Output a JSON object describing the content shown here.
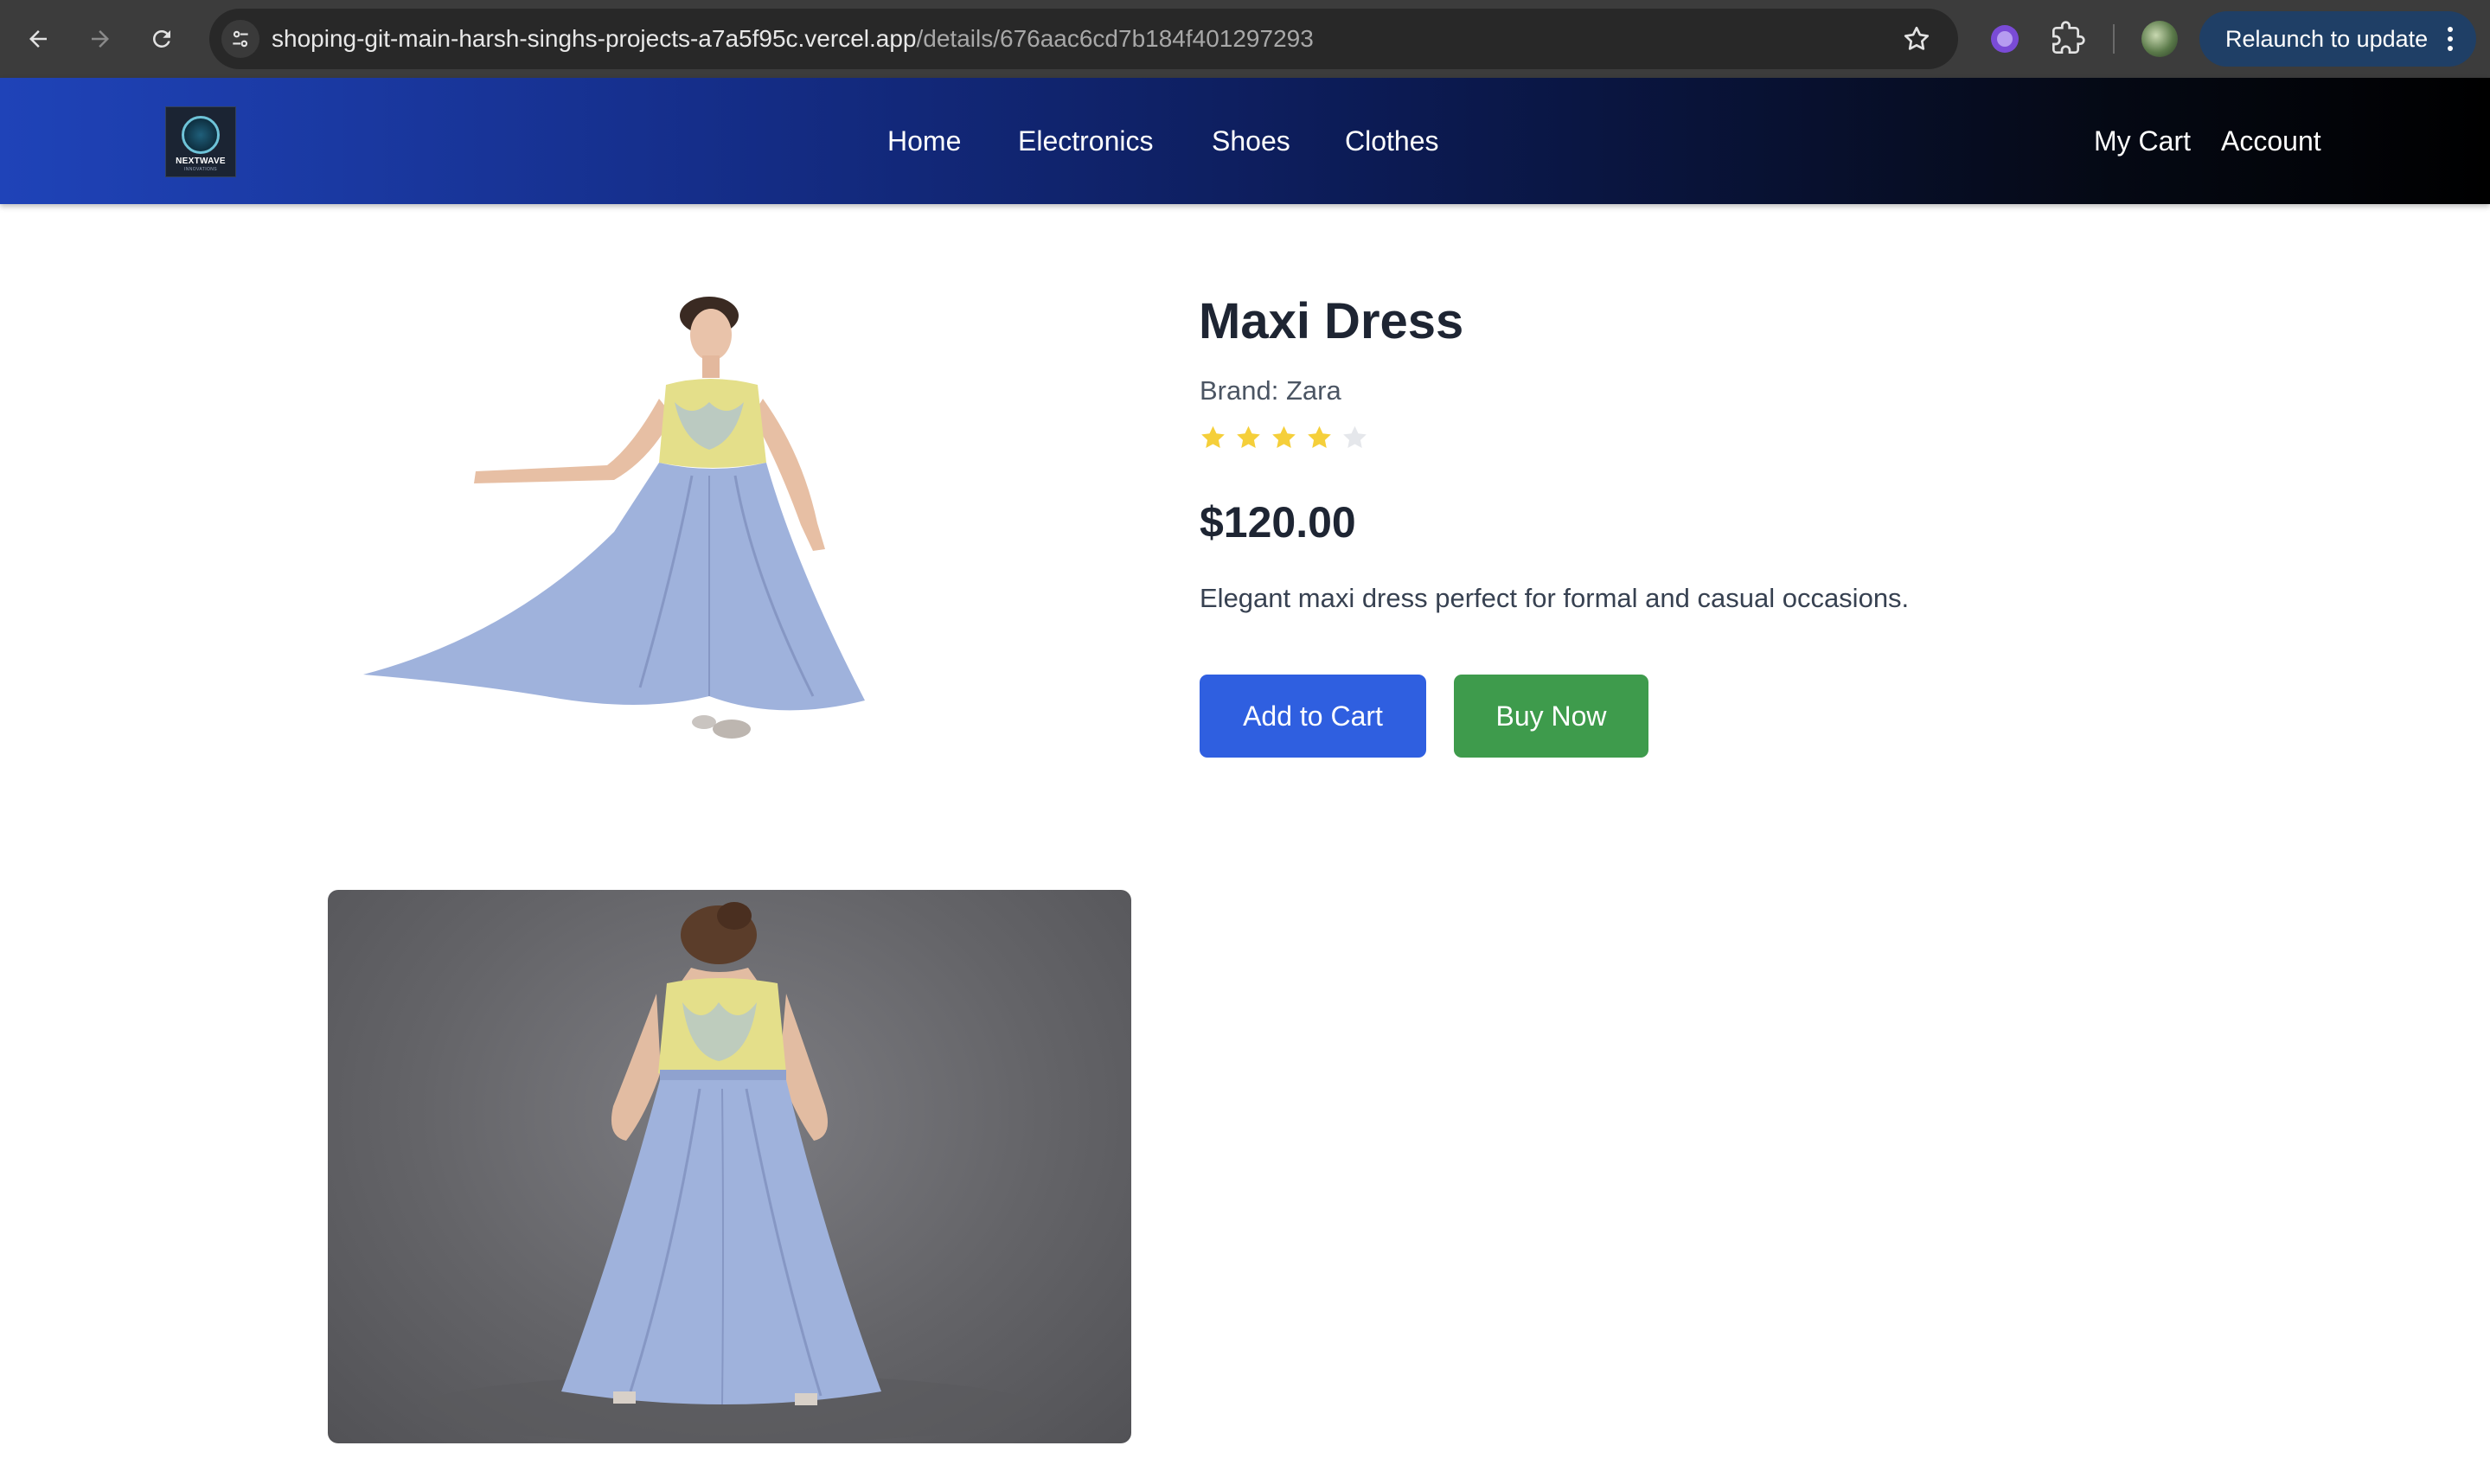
{
  "browser": {
    "url_host": "shoping-git-main-harsh-singhs-projects-a7a5f95c.vercel.app",
    "url_path": "/details/676aac6cd7b184f401297293",
    "relaunch_label": "Relaunch to update",
    "icons": [
      "back-icon",
      "forward-icon",
      "reload-icon",
      "site-info-icon",
      "bookmark-star-icon",
      "extension-icon",
      "puzzle-extensions-icon",
      "profile-avatar",
      "more-menu-icon"
    ]
  },
  "header": {
    "logo_text": "NEXTWAVE",
    "logo_subtext": "INNOVATIONS",
    "nav": {
      "home": "Home",
      "electronics": "Electronics",
      "shoes": "Shoes",
      "clothes": "Clothes"
    },
    "my_cart": "My Cart",
    "account": "Account"
  },
  "product": {
    "title": "Maxi Dress",
    "brand": "Brand: Zara",
    "rating": 4,
    "rating_max": 5,
    "price": "$120.00",
    "description": "Elegant maxi dress perfect for formal and casual occasions.",
    "add_to_cart": "Add to Cart",
    "buy_now": "Buy Now"
  },
  "colors": {
    "star_filled": "#f5cf3a",
    "star_empty": "#e5e7eb",
    "add_to_cart_bg": "#2f5fe0",
    "buy_now_bg": "#3e9b4c",
    "dress_blue": "#9fb2dc",
    "bodice_yellow": "#e4df8a"
  }
}
